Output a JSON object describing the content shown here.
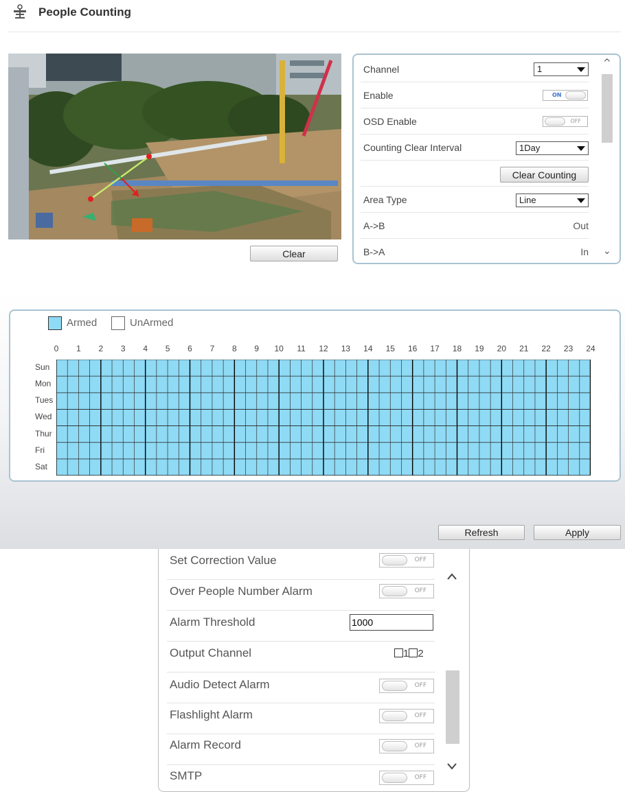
{
  "page": {
    "title": "People Counting"
  },
  "video": {
    "clear_label": "Clear"
  },
  "settings": {
    "channel_label": "Channel",
    "channel_value": "1",
    "enable_label": "Enable",
    "enable_state": "ON",
    "osd_label": "OSD Enable",
    "osd_state": "OFF",
    "interval_label": "Counting Clear Interval",
    "interval_value": "1Day",
    "clear_counting_label": "Clear Counting",
    "area_type_label": "Area Type",
    "area_type_value": "Line",
    "ab_label": "A->B",
    "ab_value": "Out",
    "ba_label": "B->A",
    "ba_value": "In"
  },
  "schedule": {
    "armed_label": "Armed",
    "unarmed_label": "UnArmed",
    "armed_color": "#8fdaf4",
    "hours": [
      "0",
      "1",
      "2",
      "3",
      "4",
      "5",
      "6",
      "7",
      "8",
      "9",
      "10",
      "11",
      "12",
      "13",
      "14",
      "15",
      "16",
      "17",
      "18",
      "19",
      "20",
      "21",
      "22",
      "23",
      "24"
    ],
    "days": [
      "Sun",
      "Mon",
      "Tues",
      "Wed",
      "Thur",
      "Fri",
      "Sat"
    ],
    "all_armed": true
  },
  "actions": {
    "refresh_label": "Refresh",
    "apply_label": "Apply"
  },
  "alarm": {
    "correction_label": "Set Correction Value",
    "correction_state": "OFF",
    "over_label": "Over People Number Alarm",
    "over_state": "OFF",
    "threshold_label": "Alarm Threshold",
    "threshold_value": "1000",
    "output_label": "Output Channel",
    "output_1": "1",
    "output_2": "2",
    "audio_label": "Audio Detect Alarm",
    "audio_state": "OFF",
    "flash_label": "Flashlight Alarm",
    "flash_state": "OFF",
    "record_label": "Alarm Record",
    "record_state": "OFF",
    "smtp_label": "SMTP",
    "smtp_state": "OFF"
  }
}
